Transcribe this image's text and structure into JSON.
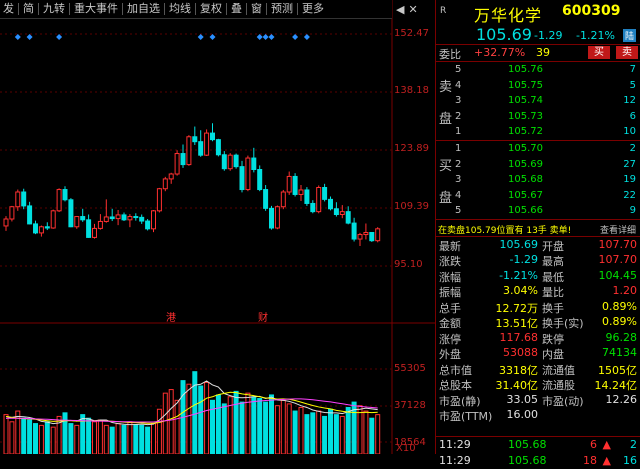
{
  "toolbar": {
    "buttons": [
      "发",
      "简",
      "九转",
      "重大事件",
      "加自选",
      "均线",
      "复权",
      "叠",
      "窗",
      "预测",
      "更多"
    ],
    "icons": [
      "◀",
      "✕"
    ]
  },
  "price_axis": [
    "152.47",
    "138.18",
    "123.89",
    "109.39",
    "95.10"
  ],
  "volume_axis": [
    "55305",
    "37128",
    "18564",
    "X10"
  ],
  "annotations": [
    "港",
    "财"
  ],
  "colors": {
    "up": "#ff3030",
    "down": "#00e0e0",
    "ma5": "#e0e0e0",
    "ma10": "#ffff00",
    "ma20": "#ff40ff",
    "diamond": "#2a8fff"
  },
  "chart_data": {
    "type": "candlestick",
    "ylim": [
      90,
      156
    ],
    "candles": [
      [
        108.1,
        110.5,
        106.9,
        109.8
      ],
      [
        109.8,
        113,
        109.2,
        112.8
      ],
      [
        112.8,
        117,
        111.8,
        116.4
      ],
      [
        116.4,
        117.2,
        112.2,
        113.0
      ],
      [
        113.0,
        114,
        108.5,
        108.6
      ],
      [
        108.6,
        109.4,
        106.1,
        106.4
      ],
      [
        106.4,
        108.2,
        105.5,
        107.9
      ],
      [
        107.9,
        109.0,
        107.1,
        107.6
      ],
      [
        107.6,
        112.1,
        107.4,
        111.8
      ],
      [
        111.8,
        117.3,
        111.5,
        117.0
      ],
      [
        117.0,
        117.8,
        114.1,
        114.5
      ],
      [
        114.5,
        114.9,
        107.8,
        107.9
      ],
      [
        107.9,
        110.5,
        107.4,
        110.4
      ],
      [
        110.4,
        112.3,
        109.1,
        109.6
      ],
      [
        109.6,
        110.9,
        105.2,
        105.3
      ],
      [
        105.3,
        108.6,
        105.0,
        107.5
      ],
      [
        107.5,
        111.0,
        107.2,
        109.2
      ],
      [
        109.2,
        114.6,
        108.9,
        110.3
      ],
      [
        110.3,
        112.3,
        109.3,
        109.9
      ],
      [
        109.9,
        112.0,
        108.3,
        110.8
      ],
      [
        110.8,
        111.4,
        109.3,
        109.6
      ],
      [
        109.6,
        111.0,
        107.8,
        110.4
      ],
      [
        110.4,
        111.2,
        109.4,
        110.2
      ],
      [
        110.2,
        110.9,
        108.6,
        109.3
      ],
      [
        109.3,
        109.8,
        107.0,
        107.4
      ],
      [
        107.4,
        112.0,
        106.6,
        111.8
      ],
      [
        111.8,
        117.4,
        111.4,
        117.2
      ],
      [
        117.2,
        120.1,
        116.6,
        119.6
      ],
      [
        119.6,
        121.1,
        118.4,
        120.8
      ],
      [
        120.8,
        126.6,
        120.4,
        125.8
      ],
      [
        125.8,
        128.0,
        122.3,
        123.1
      ],
      [
        123.1,
        130.3,
        122.8,
        129.9
      ],
      [
        129.9,
        132.4,
        127.9,
        128.7
      ],
      [
        128.7,
        131.5,
        125.0,
        125.4
      ],
      [
        125.4,
        131.7,
        125.2,
        130.8
      ],
      [
        130.8,
        133.2,
        128.8,
        129.2
      ],
      [
        129.2,
        129.4,
        125.1,
        125.5
      ],
      [
        125.5,
        126.4,
        121.6,
        122.1
      ],
      [
        122.1,
        125.9,
        121.6,
        125.4
      ],
      [
        125.4,
        125.8,
        122.1,
        122.6
      ],
      [
        122.6,
        124.0,
        116.3,
        117.0
      ],
      [
        117.0,
        125.3,
        116.6,
        124.7
      ],
      [
        124.7,
        127.2,
        121.2,
        121.9
      ],
      [
        121.9,
        122.9,
        116.6,
        117.0
      ],
      [
        117.0,
        118.1,
        111.8,
        112.4
      ],
      [
        112.4,
        113.0,
        107.2,
        107.6
      ],
      [
        107.6,
        113.1,
        107.3,
        112.8
      ],
      [
        112.8,
        116.9,
        112.2,
        116.4
      ],
      [
        116.4,
        121.4,
        115.7,
        120.2
      ],
      [
        120.2,
        121.0,
        115.3,
        115.8
      ],
      [
        115.8,
        118.1,
        114.2,
        116.9
      ],
      [
        116.9,
        117.6,
        113.0,
        113.6
      ],
      [
        113.6,
        114.4,
        111.2,
        111.6
      ],
      [
        111.6,
        118.0,
        111.2,
        117.5
      ],
      [
        117.5,
        118.4,
        114.1,
        114.6
      ],
      [
        114.6,
        115.3,
        111.9,
        112.3
      ],
      [
        112.3,
        113.9,
        110.4,
        110.9
      ],
      [
        110.9,
        113.2,
        110.0,
        111.6
      ],
      [
        111.6,
        112.9,
        108.5,
        108.8
      ],
      [
        108.8,
        110.1,
        104.3,
        104.9
      ],
      [
        104.9,
        106.4,
        103.2,
        106.0
      ],
      [
        106.0,
        108.7,
        104.8,
        106.5
      ],
      [
        106.5,
        106.6,
        104.2,
        104.5
      ],
      [
        104.5,
        107.8,
        104.1,
        107.4
      ]
    ],
    "volume": [
      22000,
      18000,
      24000,
      20000,
      19000,
      17000,
      16000,
      18000,
      15000,
      21000,
      23000,
      17000,
      16000,
      22000,
      20000,
      18000,
      19000,
      16000,
      15000,
      17000,
      16000,
      18000,
      16500,
      16000,
      15000,
      17000,
      25000,
      34000,
      36000,
      30000,
      41000,
      39000,
      46000,
      38000,
      40000,
      30000,
      33000,
      28000,
      32000,
      35000,
      29000,
      34000,
      32000,
      31000,
      29000,
      33000,
      27000,
      30000,
      28000,
      24000,
      26000,
      22000,
      23000,
      24000,
      21000,
      25000,
      22000,
      21000,
      26000,
      29000,
      27000,
      24000,
      20000,
      22000
    ],
    "ma5_vol": [
      20000,
      20500,
      21000,
      20800,
      20400,
      19600,
      18200,
      17800,
      17000,
      17400,
      18600,
      18800,
      18400,
      19800,
      19600,
      18600,
      19000,
      19000,
      17600,
      17000,
      16600,
      16400,
      16500,
      16700,
      16400,
      16700,
      19000,
      22000,
      25500,
      28500,
      33000,
      36000,
      38500,
      39000,
      40800,
      38600,
      37400,
      33800,
      32600,
      31600,
      31400,
      31600,
      32000,
      32200,
      31000,
      31800,
      30200,
      30000,
      29400,
      28400,
      27000,
      26000,
      24600,
      23800,
      23200,
      23000,
      23000,
      22600,
      23600,
      24800,
      25000,
      25600,
      25200,
      24800
    ],
    "ma10_vol": [
      21000,
      20500,
      20000,
      19800,
      19600,
      19400,
      19000,
      18600,
      18200,
      18400,
      18600,
      18600,
      18400,
      18400,
      18500,
      18500,
      18500,
      18400,
      18300,
      18100,
      17800,
      17600,
      17500,
      17400,
      17200,
      17200,
      17600,
      18600,
      19700,
      21000,
      23300,
      25500,
      27500,
      29000,
      31200,
      32000,
      33200,
      33900,
      34500,
      34300,
      33600,
      33100,
      32600,
      32000,
      31300,
      31100,
      30700,
      30800,
      30600,
      29900,
      29000,
      28000,
      27100,
      26300,
      25700,
      25200,
      24400,
      23900,
      23400,
      23200,
      23100,
      23300,
      23100,
      23300
    ],
    "ma20_vol": [
      20000,
      20000,
      20000,
      19900,
      19800,
      19600,
      19500,
      19400,
      19200,
      19000,
      18900,
      18800,
      18700,
      18600,
      18500,
      18400,
      18400,
      18300,
      18200,
      18100,
      18000,
      18000,
      17900,
      17900,
      17900,
      17900,
      18200,
      18600,
      19000,
      19700,
      20500,
      21400,
      22300,
      23300,
      24300,
      25000,
      25700,
      26400,
      27100,
      27800,
      28400,
      28900,
      29300,
      29600,
      29900,
      30100,
      30300,
      30500,
      30700,
      30800,
      30800,
      30600,
      30300,
      29900,
      29500,
      29100,
      28600,
      28100,
      27500,
      27000,
      26600,
      26300,
      26000,
      25700
    ],
    "diamond_positions": [
      2,
      4,
      9,
      33,
      35,
      43,
      44,
      45,
      49,
      51
    ]
  },
  "stock": {
    "tag": "R",
    "name": "万华化学",
    "code": "600309",
    "price": "105.69",
    "change": "-1.29",
    "pct": "-1.21%",
    "market_tag": "陆"
  },
  "weibi": {
    "label": "委比",
    "value": "+32.77%",
    "diff": "39",
    "buy_btn": "买",
    "sell_btn": "卖"
  },
  "sell_book": {
    "label": [
      "卖",
      "盘"
    ],
    "rows": [
      {
        "lv": "5",
        "price": "105.76",
        "vol": "7"
      },
      {
        "lv": "4",
        "price": "105.75",
        "vol": "5"
      },
      {
        "lv": "3",
        "price": "105.74",
        "vol": "12"
      },
      {
        "lv": "2",
        "price": "105.73",
        "vol": "6"
      },
      {
        "lv": "1",
        "price": "105.72",
        "vol": "10"
      }
    ]
  },
  "buy_book": {
    "label": [
      "买",
      "盘"
    ],
    "rows": [
      {
        "lv": "1",
        "price": "105.70",
        "vol": "2"
      },
      {
        "lv": "2",
        "price": "105.69",
        "vol": "27"
      },
      {
        "lv": "3",
        "price": "105.68",
        "vol": "19"
      },
      {
        "lv": "4",
        "price": "105.67",
        "vol": "22"
      },
      {
        "lv": "5",
        "price": "105.66",
        "vol": "9"
      }
    ]
  },
  "trade_line": {
    "text": "在卖盘105.79位置有 13手 卖单!",
    "detail": "查看详细"
  },
  "stats": [
    {
      "k1": "最新",
      "v1": "105.69",
      "c1": "cyan",
      "k2": "开盘",
      "v2": "107.70",
      "c2": "red"
    },
    {
      "k1": "涨跌",
      "v1": "-1.29",
      "c1": "cyan",
      "k2": "最高",
      "v2": "107.70",
      "c2": "red"
    },
    {
      "k1": "涨幅",
      "v1": "-1.21%",
      "c1": "cyan",
      "k2": "最低",
      "v2": "104.45",
      "c2": "green"
    },
    {
      "k1": "振幅",
      "v1": "3.04%",
      "c1": "yellow",
      "k2": "量比",
      "v2": "1.20",
      "c2": "red"
    },
    {
      "k1": "总手",
      "v1": "12.72万",
      "c1": "yellow",
      "k2": "换手",
      "v2": "0.89%",
      "c2": "yellow"
    },
    {
      "k1": "金额",
      "v1": "13.51亿",
      "c1": "yellow",
      "k2": "换手(实)",
      "v2": "0.89%",
      "c2": "yellow"
    },
    {
      "k1": "涨停",
      "v1": "117.68",
      "c1": "red",
      "k2": "跌停",
      "v2": "96.28",
      "c2": "green"
    },
    {
      "k1": "外盘",
      "v1": "53088",
      "c1": "red",
      "k2": "内盘",
      "v2": "74134",
      "c2": "green"
    },
    {
      "k1": "总市值",
      "v1": "3318亿",
      "c1": "yellow",
      "k2": "流通值",
      "v2": "1505亿",
      "c2": "yellow"
    },
    {
      "k1": "总股本",
      "v1": "31.40亿",
      "c1": "yellow",
      "k2": "流通股",
      "v2": "14.24亿",
      "c2": "yellow"
    },
    {
      "k1": "市盈(静)",
      "v1": "33.05",
      "c1": "white",
      "k2": "市盈(动)",
      "v2": "12.26",
      "c2": "white"
    },
    {
      "k1": "市盈(TTM)",
      "v1": "16.00",
      "c1": "white",
      "k2": "",
      "v2": "",
      "c2": "white"
    }
  ],
  "ticks": [
    {
      "time": "11:29",
      "price": "105.68",
      "vol": "6",
      "arrow": "▲",
      "n": "2"
    },
    {
      "time": "11:29",
      "price": "105.68",
      "vol": "18",
      "arrow": "▲",
      "n": "16"
    }
  ]
}
